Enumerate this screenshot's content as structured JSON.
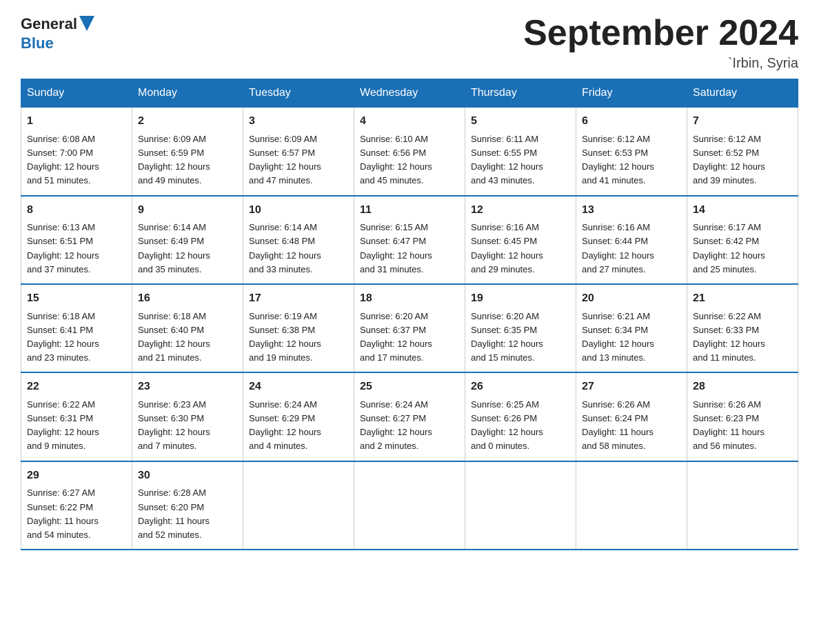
{
  "header": {
    "logo_text_black": "General",
    "logo_text_blue": "Blue",
    "month_title": "September 2024",
    "location": "`Irbin, Syria"
  },
  "weekdays": [
    "Sunday",
    "Monday",
    "Tuesday",
    "Wednesday",
    "Thursday",
    "Friday",
    "Saturday"
  ],
  "weeks": [
    [
      {
        "day": "1",
        "sunrise": "6:08 AM",
        "sunset": "7:00 PM",
        "daylight": "12 hours and 51 minutes."
      },
      {
        "day": "2",
        "sunrise": "6:09 AM",
        "sunset": "6:59 PM",
        "daylight": "12 hours and 49 minutes."
      },
      {
        "day": "3",
        "sunrise": "6:09 AM",
        "sunset": "6:57 PM",
        "daylight": "12 hours and 47 minutes."
      },
      {
        "day": "4",
        "sunrise": "6:10 AM",
        "sunset": "6:56 PM",
        "daylight": "12 hours and 45 minutes."
      },
      {
        "day": "5",
        "sunrise": "6:11 AM",
        "sunset": "6:55 PM",
        "daylight": "12 hours and 43 minutes."
      },
      {
        "day": "6",
        "sunrise": "6:12 AM",
        "sunset": "6:53 PM",
        "daylight": "12 hours and 41 minutes."
      },
      {
        "day": "7",
        "sunrise": "6:12 AM",
        "sunset": "6:52 PM",
        "daylight": "12 hours and 39 minutes."
      }
    ],
    [
      {
        "day": "8",
        "sunrise": "6:13 AM",
        "sunset": "6:51 PM",
        "daylight": "12 hours and 37 minutes."
      },
      {
        "day": "9",
        "sunrise": "6:14 AM",
        "sunset": "6:49 PM",
        "daylight": "12 hours and 35 minutes."
      },
      {
        "day": "10",
        "sunrise": "6:14 AM",
        "sunset": "6:48 PM",
        "daylight": "12 hours and 33 minutes."
      },
      {
        "day": "11",
        "sunrise": "6:15 AM",
        "sunset": "6:47 PM",
        "daylight": "12 hours and 31 minutes."
      },
      {
        "day": "12",
        "sunrise": "6:16 AM",
        "sunset": "6:45 PM",
        "daylight": "12 hours and 29 minutes."
      },
      {
        "day": "13",
        "sunrise": "6:16 AM",
        "sunset": "6:44 PM",
        "daylight": "12 hours and 27 minutes."
      },
      {
        "day": "14",
        "sunrise": "6:17 AM",
        "sunset": "6:42 PM",
        "daylight": "12 hours and 25 minutes."
      }
    ],
    [
      {
        "day": "15",
        "sunrise": "6:18 AM",
        "sunset": "6:41 PM",
        "daylight": "12 hours and 23 minutes."
      },
      {
        "day": "16",
        "sunrise": "6:18 AM",
        "sunset": "6:40 PM",
        "daylight": "12 hours and 21 minutes."
      },
      {
        "day": "17",
        "sunrise": "6:19 AM",
        "sunset": "6:38 PM",
        "daylight": "12 hours and 19 minutes."
      },
      {
        "day": "18",
        "sunrise": "6:20 AM",
        "sunset": "6:37 PM",
        "daylight": "12 hours and 17 minutes."
      },
      {
        "day": "19",
        "sunrise": "6:20 AM",
        "sunset": "6:35 PM",
        "daylight": "12 hours and 15 minutes."
      },
      {
        "day": "20",
        "sunrise": "6:21 AM",
        "sunset": "6:34 PM",
        "daylight": "12 hours and 13 minutes."
      },
      {
        "day": "21",
        "sunrise": "6:22 AM",
        "sunset": "6:33 PM",
        "daylight": "12 hours and 11 minutes."
      }
    ],
    [
      {
        "day": "22",
        "sunrise": "6:22 AM",
        "sunset": "6:31 PM",
        "daylight": "12 hours and 9 minutes."
      },
      {
        "day": "23",
        "sunrise": "6:23 AM",
        "sunset": "6:30 PM",
        "daylight": "12 hours and 7 minutes."
      },
      {
        "day": "24",
        "sunrise": "6:24 AM",
        "sunset": "6:29 PM",
        "daylight": "12 hours and 4 minutes."
      },
      {
        "day": "25",
        "sunrise": "6:24 AM",
        "sunset": "6:27 PM",
        "daylight": "12 hours and 2 minutes."
      },
      {
        "day": "26",
        "sunrise": "6:25 AM",
        "sunset": "6:26 PM",
        "daylight": "12 hours and 0 minutes."
      },
      {
        "day": "27",
        "sunrise": "6:26 AM",
        "sunset": "6:24 PM",
        "daylight": "11 hours and 58 minutes."
      },
      {
        "day": "28",
        "sunrise": "6:26 AM",
        "sunset": "6:23 PM",
        "daylight": "11 hours and 56 minutes."
      }
    ],
    [
      {
        "day": "29",
        "sunrise": "6:27 AM",
        "sunset": "6:22 PM",
        "daylight": "11 hours and 54 minutes."
      },
      {
        "day": "30",
        "sunrise": "6:28 AM",
        "sunset": "6:20 PM",
        "daylight": "11 hours and 52 minutes."
      },
      null,
      null,
      null,
      null,
      null
    ]
  ],
  "labels": {
    "sunrise": "Sunrise:",
    "sunset": "Sunset:",
    "daylight": "Daylight:"
  }
}
